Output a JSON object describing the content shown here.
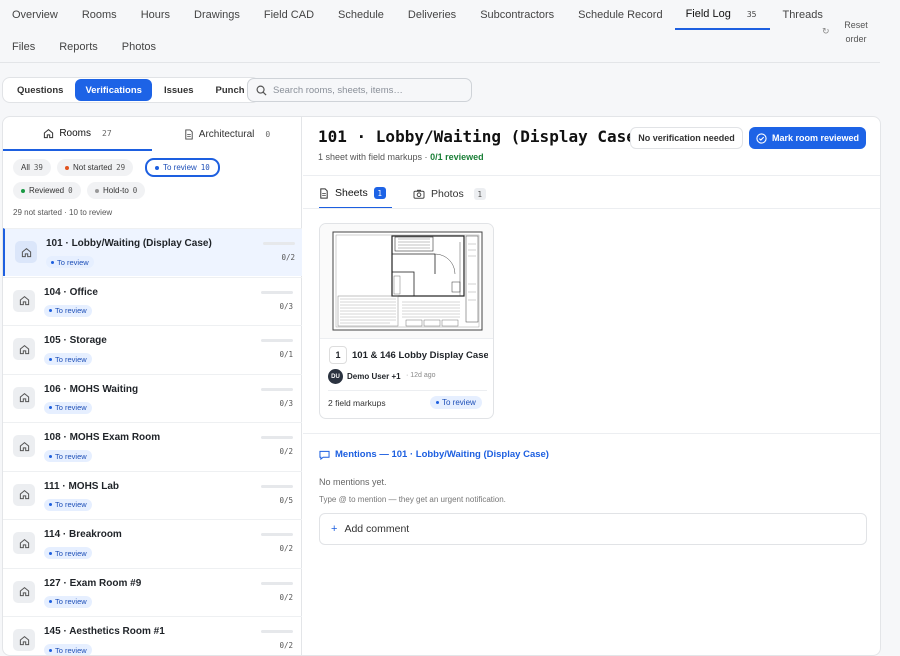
{
  "nav": {
    "row1": [
      {
        "label": "Overview"
      },
      {
        "label": "Rooms"
      },
      {
        "label": "Hours"
      },
      {
        "label": "Drawings"
      },
      {
        "label": "Field CAD"
      },
      {
        "label": "Schedule"
      },
      {
        "label": "Deliveries"
      },
      {
        "label": "Subcontractors"
      },
      {
        "label": "Schedule Record"
      },
      {
        "label": "Field Log",
        "count": "35"
      },
      {
        "label": "Threads"
      }
    ],
    "row2": [
      {
        "label": "Files"
      },
      {
        "label": "Reports"
      },
      {
        "label": "Photos"
      }
    ],
    "reset_label": "Reset order",
    "reset_icon": "rotate-icon"
  },
  "segments": [
    "Questions",
    "Verifications",
    "Issues",
    "Punch"
  ],
  "search": {
    "placeholder": "Search rooms, sheets, items…"
  },
  "left": {
    "tabs": [
      {
        "label": "Rooms",
        "count": "27"
      },
      {
        "label": "Architectural",
        "count": "0"
      }
    ],
    "chips": {
      "all": {
        "label": "All",
        "count": "39"
      },
      "not_started": {
        "label": "Not started",
        "count": "29"
      },
      "to_review": {
        "label": "To review",
        "count": "10"
      },
      "reviewed": {
        "label": "Reviewed",
        "count": "0"
      },
      "hold_to": {
        "label": "Hold-to",
        "count": "0"
      }
    },
    "summary": "29 not started · 10 to review",
    "rooms": [
      {
        "name": "101 · Lobby/Waiting (Display Case)",
        "status": "To review",
        "progress": "0/2",
        "reviewed": 0,
        "total": 2
      },
      {
        "name": "104 · Office",
        "status": "To review",
        "progress": "0/3",
        "reviewed": 0,
        "total": 3
      },
      {
        "name": "105 · Storage",
        "status": "To review",
        "progress": "0/1",
        "reviewed": 0,
        "total": 1
      },
      {
        "name": "106 · MOHS Waiting",
        "status": "To review",
        "progress": "0/3",
        "reviewed": 0,
        "total": 3
      },
      {
        "name": "108 · MOHS Exam Room",
        "status": "To review",
        "progress": "0/2",
        "reviewed": 0,
        "total": 2
      },
      {
        "name": "111 · MOHS Lab",
        "status": "To review",
        "progress": "0/5",
        "reviewed": 0,
        "total": 5
      },
      {
        "name": "114 · Breakroom",
        "status": "To review",
        "progress": "0/2",
        "reviewed": 0,
        "total": 2
      },
      {
        "name": "127 · Exam Room #9",
        "status": "To review",
        "progress": "0/2",
        "reviewed": 0,
        "total": 2
      },
      {
        "name": "145 · Aesthetics Room #1",
        "status": "To review",
        "progress": "0/2",
        "reviewed": 0,
        "total": 2
      }
    ]
  },
  "detail": {
    "title": "101 · Lobby/Waiting (Display Case)",
    "subtitle_prefix": "1 sheet with field markups · ",
    "subtitle_reviewed": "0/1 reviewed",
    "no_verification_label": "No verification needed",
    "mark_reviewed_label": "Mark room reviewed",
    "tabs": [
      {
        "label": "Sheets",
        "count": "1"
      },
      {
        "label": "Photos",
        "count": "1"
      }
    ],
    "sheet": {
      "number": "1",
      "title": "101 & 146 Lobby Display Case",
      "avatar": "DU",
      "user": "Demo User +1",
      "ago": "· 12d ago",
      "markups": "2 field markups",
      "status": "To review"
    },
    "mentions_title": "Mentions — 101 · Lobby/Waiting (Display Case)",
    "no_mentions": "No mentions yet.",
    "hint": "Type @ to mention — they get an urgent notification.",
    "add_comment": "Add comment"
  },
  "colors": {
    "accent": "#1d63e6",
    "success": "#1a7f37",
    "badge_bg": "#e6efff"
  }
}
